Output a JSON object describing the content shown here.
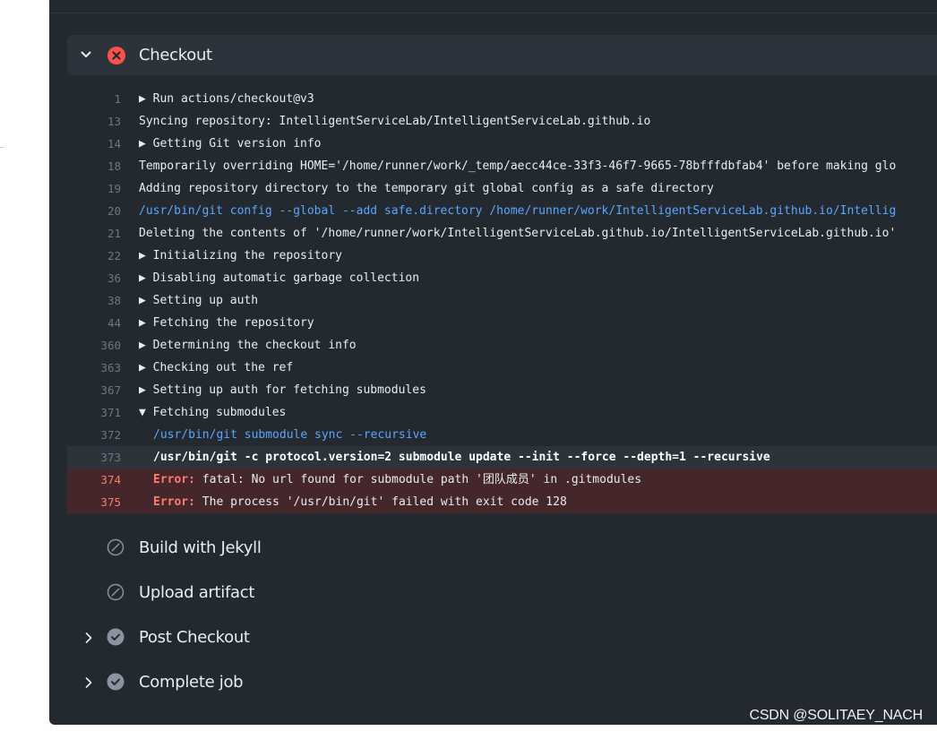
{
  "job": {
    "active_step": {
      "title": "Checkout",
      "status": "failed",
      "expanded": true,
      "log": [
        {
          "num": "1",
          "text": "Run actions/checkout@v3",
          "group": "collapsed"
        },
        {
          "num": "13",
          "text": "Syncing repository: IntelligentServiceLab/IntelligentServiceLab.github.io"
        },
        {
          "num": "14",
          "text": "Getting Git version info",
          "group": "collapsed"
        },
        {
          "num": "18",
          "text": "Temporarily overriding HOME='/home/runner/work/_temp/aecc44ce-33f3-46f7-9665-78bfffdbfab4' before making glo"
        },
        {
          "num": "19",
          "text": "Adding repository directory to the temporary git global config as a safe directory"
        },
        {
          "num": "20",
          "text": "/usr/bin/git config --global --add safe.directory /home/runner/work/IntelligentServiceLab.github.io/Intellig",
          "kind": "command"
        },
        {
          "num": "21",
          "text": "Deleting the contents of '/home/runner/work/IntelligentServiceLab.github.io/IntelligentServiceLab.github.io'"
        },
        {
          "num": "22",
          "text": "Initializing the repository",
          "group": "collapsed"
        },
        {
          "num": "36",
          "text": "Disabling automatic garbage collection",
          "group": "collapsed"
        },
        {
          "num": "38",
          "text": "Setting up auth",
          "group": "collapsed"
        },
        {
          "num": "44",
          "text": "Fetching the repository",
          "group": "collapsed"
        },
        {
          "num": "360",
          "text": "Determining the checkout info",
          "group": "collapsed"
        },
        {
          "num": "363",
          "text": "Checking out the ref",
          "group": "collapsed"
        },
        {
          "num": "367",
          "text": "Setting up auth for fetching submodules",
          "group": "collapsed"
        },
        {
          "num": "371",
          "text": "Fetching submodules",
          "group": "expanded"
        },
        {
          "num": "372",
          "text": "/usr/bin/git submodule sync --recursive",
          "kind": "command",
          "indent": true
        },
        {
          "num": "373",
          "text": "/usr/bin/git -c protocol.version=2 submodule update --init --force --depth=1 --recursive",
          "kind": "highlight",
          "indent": true
        },
        {
          "num": "374",
          "prefix": "Error:",
          "text": " fatal: No url found for submodule path '团队成员' in .gitmodules",
          "kind": "error",
          "indent": true
        },
        {
          "num": "375",
          "prefix": "Error:",
          "text": " The process '/usr/bin/git' failed with exit code 128",
          "kind": "error",
          "indent": true
        }
      ]
    },
    "other_steps": [
      {
        "title": "Build with Jekyll",
        "status": "skipped"
      },
      {
        "title": "Upload artifact",
        "status": "skipped"
      },
      {
        "title": "Post Checkout",
        "status": "success"
      },
      {
        "title": "Complete job",
        "status": "success"
      }
    ]
  },
  "glyphs": {
    "collapsed": "▶",
    "expanded": "▼"
  },
  "colors": {
    "panel_bg": "#24292f",
    "header_bg": "#2d333b",
    "text": "#e6edf3",
    "line_number": "#6e7681",
    "command": "#58a6ff",
    "error": "#ff7b72",
    "error_row_bg": "#45262b",
    "failed_icon": "#f85149",
    "status_icon": "#8b949e"
  },
  "icons": {
    "failed": "x-circle-fill-icon",
    "skipped": "skip-icon",
    "success": "check-circle-fill-icon",
    "expand": "chevron-down-icon",
    "collapse": "chevron-right-icon"
  },
  "watermark": "CSDN @SOLITAEY_NACH"
}
